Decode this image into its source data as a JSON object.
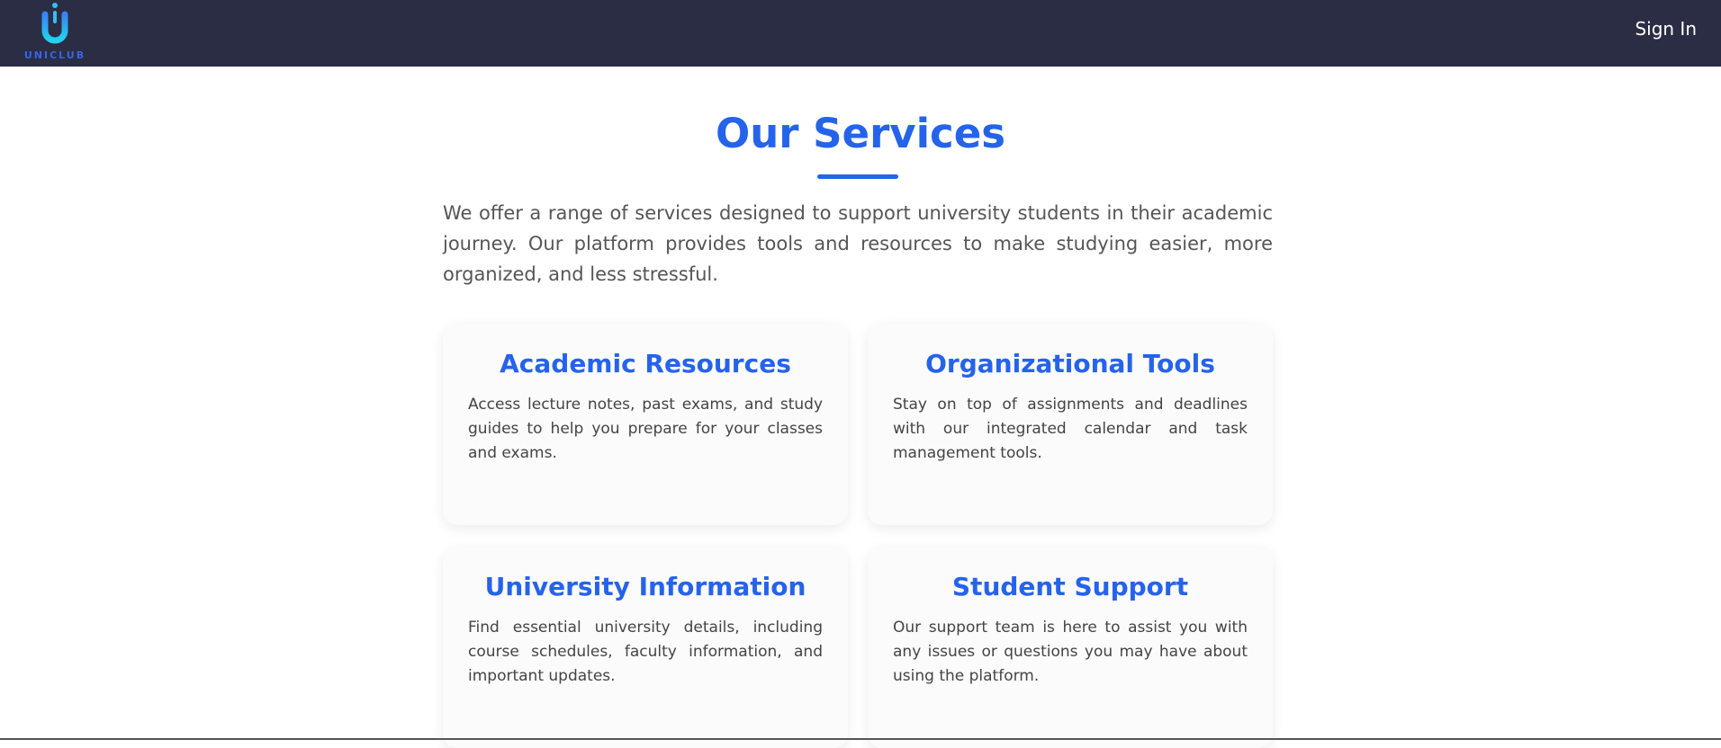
{
  "header": {
    "logo_text": "UNICLUB",
    "signin_label": "Sign In"
  },
  "main": {
    "title": "Our Services",
    "intro": "We offer a range of services designed to support university students in their academic journey. Our platform provides tools and resources to make studying easier, more organized, and less stressful.",
    "services": [
      {
        "title": "Academic Resources",
        "description": "Access lecture notes, past exams, and study guides to help you prepare for your classes and exams."
      },
      {
        "title": "Organizational Tools",
        "description": "Stay on top of assignments and deadlines with our integrated calendar and task management tools."
      },
      {
        "title": "University Information",
        "description": "Find essential university details, including course schedules, faculty information, and important updates."
      },
      {
        "title": "Student Support",
        "description": "Our support team is here to assist you with any issues or questions you may have about using the platform."
      }
    ]
  },
  "colors": {
    "navbar_bg": "#2a2d43",
    "accent": "#2563eb",
    "text": "#555555"
  }
}
